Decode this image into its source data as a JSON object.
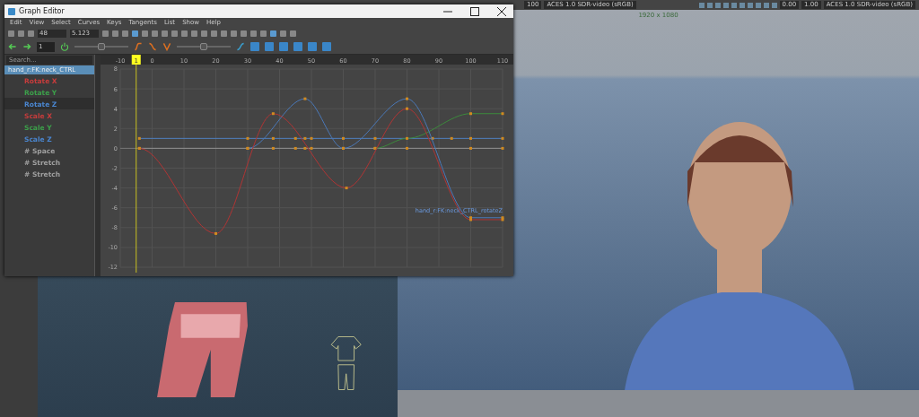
{
  "app_toolbar": {
    "left_fields": [
      "100"
    ],
    "left_colorspace": "ACES 1.0 SDR-video (sRGB)",
    "right_fields": [
      "0.00",
      "1.00"
    ],
    "right_colorspace": "ACES 1.0 SDR-video (sRGB)"
  },
  "viewport_right": {
    "resolution": "1920 x 1080"
  },
  "graph_editor": {
    "title": "Graph Editor",
    "menu": [
      "Edit",
      "View",
      "Select",
      "Curves",
      "Keys",
      "Tangents",
      "List",
      "Show",
      "Help"
    ],
    "key_fields": [
      "48",
      "5.123"
    ],
    "frame_field": "1",
    "weight_slider": {
      "level": 0.5
    },
    "tangent_slider": {
      "level": 0.5
    },
    "outliner": {
      "placeholder": "Search...",
      "root": "hand_r:FK:neck_CTRL",
      "items": [
        {
          "label": "Rotate X",
          "color": "#c83c3c",
          "selected": false
        },
        {
          "label": "Rotate Y",
          "color": "#3ca04a",
          "selected": false
        },
        {
          "label": "Rotate Z",
          "color": "#4a86d0",
          "selected": true
        },
        {
          "label": "Scale X",
          "color": "#c83c3c",
          "selected": false
        },
        {
          "label": "Scale Y",
          "color": "#3ca04a",
          "selected": false
        },
        {
          "label": "Scale Z",
          "color": "#4a86d0",
          "selected": false
        },
        {
          "label": "# Space",
          "color": "#a0a0a0",
          "selected": false
        },
        {
          "label": "# Stretch",
          "color": "#a0a0a0",
          "selected": false
        },
        {
          "label": "# Stretch",
          "color": "#a0a0a0",
          "selected": false
        }
      ]
    },
    "current_frame": "1",
    "chart_data": {
      "type": "line",
      "xlim": [
        -10,
        110
      ],
      "ylim": [
        -12,
        8
      ],
      "grid": true,
      "xticks": [
        -10,
        0,
        10,
        20,
        30,
        40,
        50,
        60,
        70,
        80,
        90,
        100,
        110
      ],
      "yticks": [
        8,
        6,
        4,
        2,
        0,
        -2,
        -4,
        -6,
        -8,
        -10,
        -12
      ],
      "series": [
        {
          "color": "#b03434",
          "x": [
            -4,
            20,
            38,
            61,
            80,
            100,
            110
          ],
          "values": [
            0,
            -8.6,
            3.5,
            -4,
            4,
            -7.2,
            -7.2
          ]
        },
        {
          "color": "#4a78b8",
          "x": [
            30,
            48,
            60,
            80,
            100,
            110
          ],
          "values": [
            0,
            5,
            0,
            5,
            -7,
            -7
          ]
        },
        {
          "color": "#3c8a3c",
          "x": [
            70,
            80,
            100,
            110
          ],
          "values": [
            0,
            1,
            3.5,
            3.5
          ]
        },
        {
          "color": "#5080c0",
          "x": [
            -4,
            30,
            38,
            45,
            48,
            50,
            60,
            70,
            88,
            94,
            100,
            110
          ],
          "values": [
            1,
            1,
            1,
            1,
            1,
            1,
            1,
            1,
            1,
            1,
            1,
            1
          ]
        },
        {
          "color": "#8a8a8a",
          "x": [
            -4,
            30,
            38,
            45,
            48,
            50,
            60,
            70,
            80,
            100,
            110
          ],
          "values": [
            0,
            0,
            0,
            0,
            0,
            0,
            0,
            0,
            0,
            0,
            0
          ]
        }
      ],
      "ref_lines": [
        {
          "axis": "x",
          "value": -5,
          "color": "#c8c020"
        }
      ],
      "annotations": [
        {
          "x": 110,
          "y": -7,
          "text": "hand_r:FK:neck_CTRL_rotateZ"
        }
      ]
    }
  }
}
